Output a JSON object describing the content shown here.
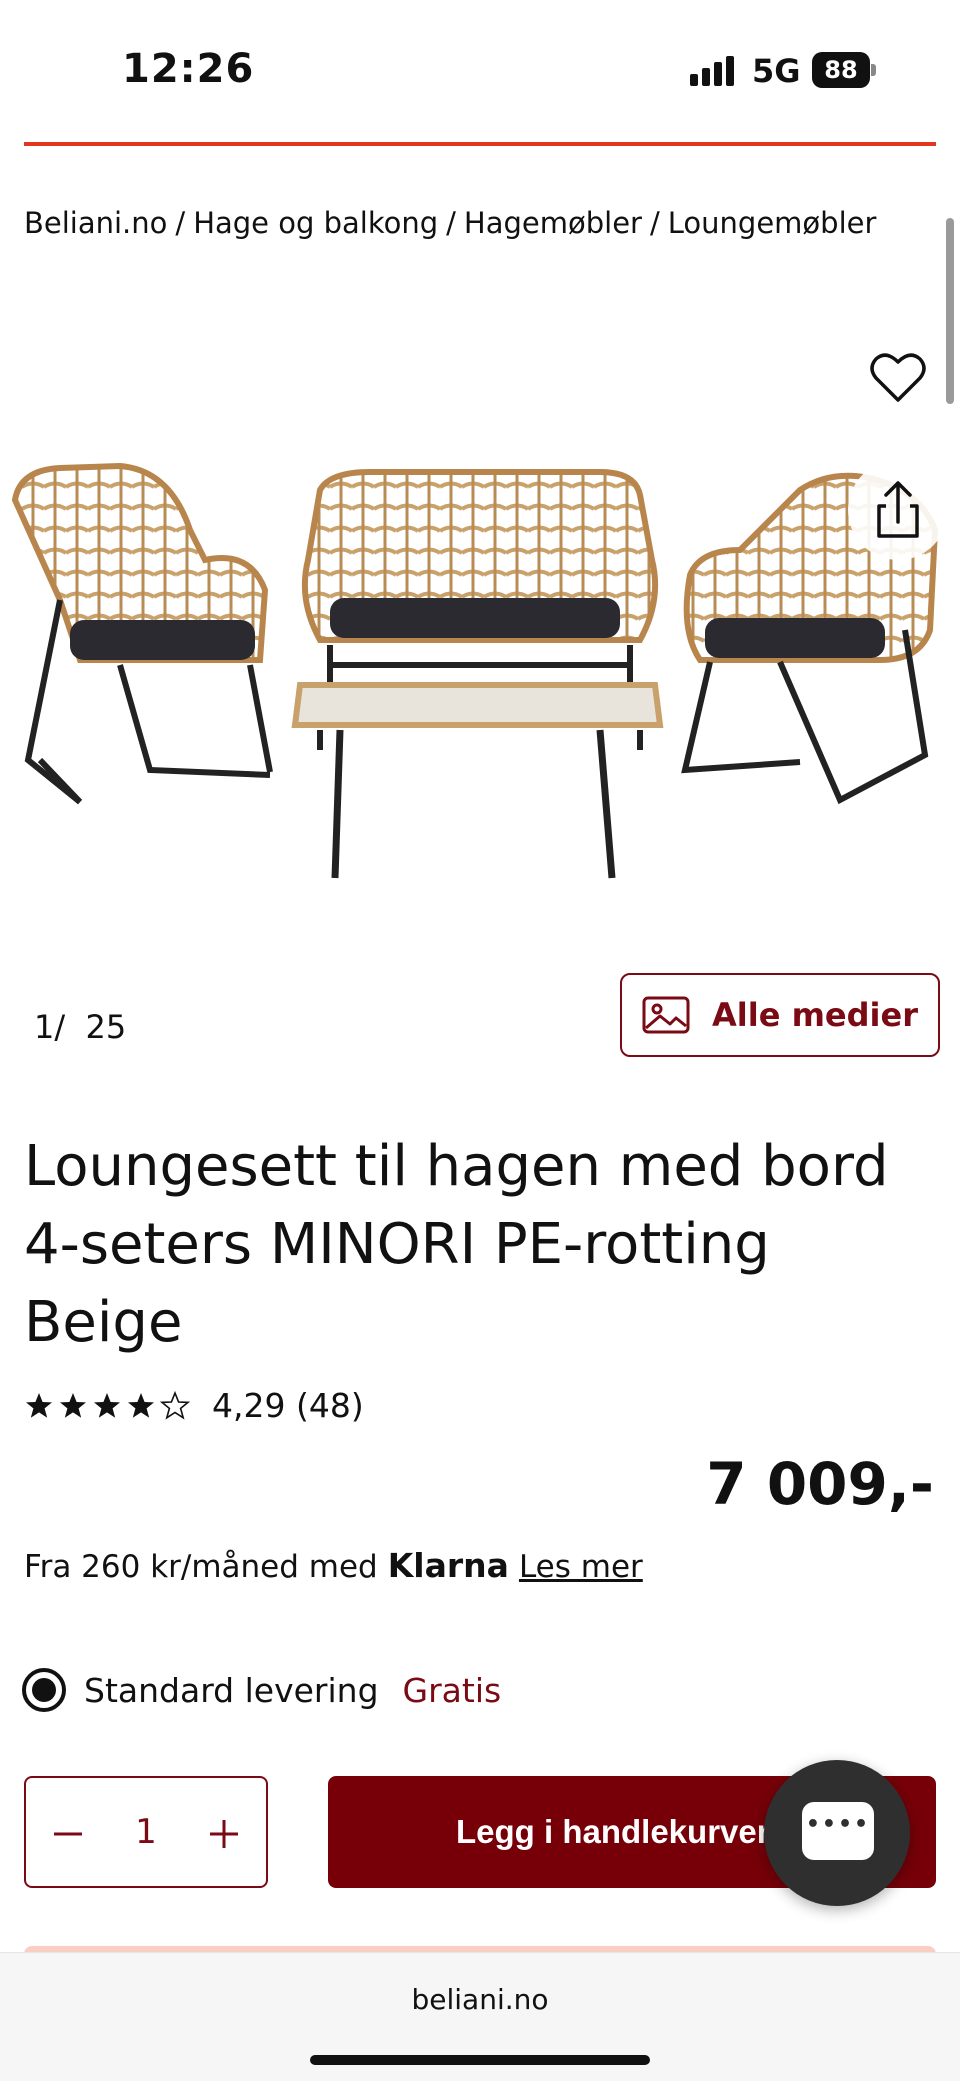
{
  "status_bar": {
    "time": "12:26",
    "network": "5G",
    "battery": "88"
  },
  "breadcrumb": {
    "items": [
      "Beliani.no",
      "Hage og balkong",
      "Hagemøbler",
      "Loungemøbler"
    ],
    "separator": "/"
  },
  "gallery": {
    "counter_current": "1/",
    "counter_total": "25",
    "all_media_label": "Alle medier",
    "favorite_icon": "heart-icon",
    "share_icon": "share-icon"
  },
  "product": {
    "title": "Loungesett til hagen med bord 4-seters MINORI PE-rotting Beige",
    "rating_value": 4.29,
    "rating_text": "4,29 (48)",
    "price": "7 009,-"
  },
  "klarna": {
    "prefix": "Fra 260 kr/måned med",
    "brand": "Klarna",
    "link": "Les mer"
  },
  "delivery": {
    "label": "Standard levering",
    "price": "Gratis",
    "selected": true
  },
  "cart": {
    "quantity": "1",
    "add_label": "Legg i handlekurven"
  },
  "browser": {
    "domain": "beliani.no"
  },
  "colors": {
    "brand_red": "#770008",
    "accent_line": "#e2361f",
    "rattan": "#c9a16b"
  }
}
